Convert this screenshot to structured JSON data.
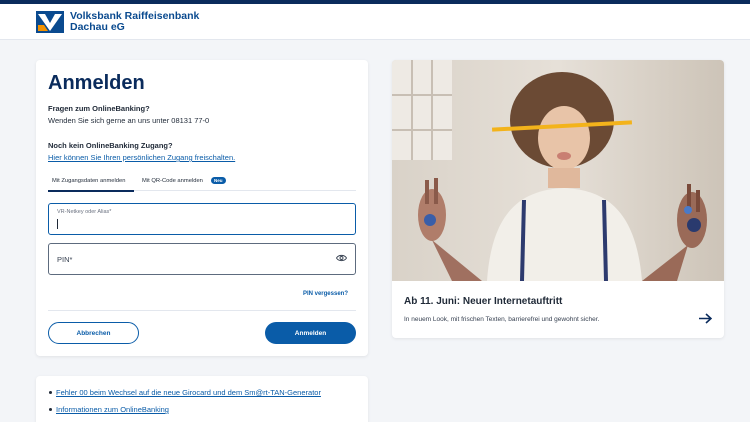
{
  "header": {
    "bank_name_line1": "Volksbank Raiffeisenbank",
    "bank_name_line2": "Dachau eG",
    "logo_icon": "volksbank-logo-icon"
  },
  "login": {
    "title": "Anmelden",
    "question1": "Fragen zum OnlineBanking?",
    "answer1": "Wenden Sie sich gerne an uns unter 08131 77-0",
    "question2": "Noch kein OnlineBanking Zugang?",
    "answer2": "Hier können Sie Ihren persönlichen Zugang freischalten.",
    "tabs": [
      {
        "label": "Mit Zugangsdaten anmelden",
        "active": true
      },
      {
        "label": "Mit QR-Code anmelden",
        "badge": "Neu"
      }
    ],
    "username_label": "VR-Netkey oder Alias*",
    "username_value": "",
    "pin_label": "PIN*",
    "pin_forgot": "PIN vergessen?",
    "cancel_label": "Abbrechen",
    "submit_label": "Anmelden"
  },
  "promo": {
    "title": "Ab 11. Juni: Neuer Internetauftritt",
    "text": "In neuem Look, mit frischen Texten, barrierefrei und gewohnt sicher."
  },
  "links": [
    "Fehler 00 beim Wechsel auf die neue Girocard und dem Sm@rt-TAN-Generator",
    "Informationen zum OnlineBanking"
  ],
  "colors": {
    "brand_dark": "#0a2b5c",
    "brand_blue": "#0a5ca8",
    "accent_orange": "#f39200"
  }
}
